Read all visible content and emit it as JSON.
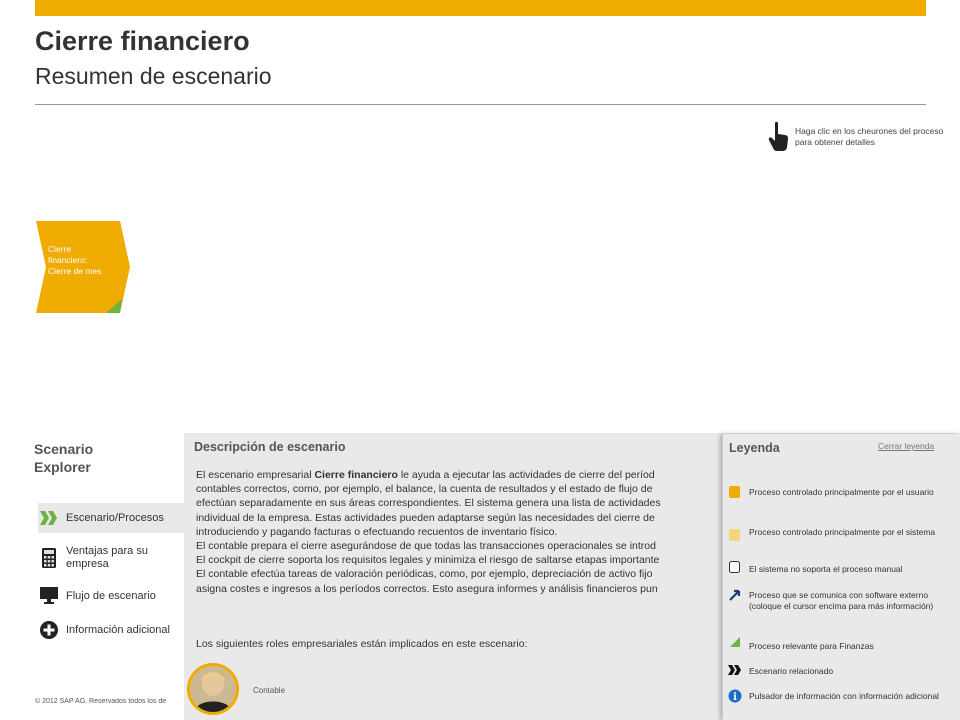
{
  "header": {
    "title": "Cierre financiero",
    "subtitle": "Resumen de escenario",
    "accent_color": "#f0ab00"
  },
  "hint": {
    "icon": "hand-pointer-icon",
    "text": "Haga clic en los cheurones del proceso para obtener detalles"
  },
  "process": {
    "chevron_label": "Cierre financiero: Cierre de mes",
    "chevron_color": "#f0ab00",
    "corner_color": "#6db33f"
  },
  "explorer": {
    "title": "Scenario Explorer",
    "items": [
      {
        "label": "Escenario/Procesos",
        "icon": "double-chevron-icon"
      },
      {
        "label": "Ventajas para su empresa",
        "icon": "calculator-icon"
      },
      {
        "label": "Flujo de escenario",
        "icon": "monitor-icon"
      },
      {
        "label": "Información adicional",
        "icon": "plus-circle-icon"
      }
    ]
  },
  "footer": {
    "copyright": "© 2012 SAP AG. Reservados todos los de"
  },
  "description": {
    "title": "Descripción de escenario",
    "lines": {
      "l1_pre": "El escenario empresarial ",
      "l1_bold": "Cierre financiero",
      "l1_post": " le ayuda a ejecutar las actividades de cierre del períod",
      "l2": "contables correctos, como, por ejemplo, el balance, la cuenta de resultados y el estado de flujo de",
      "l3": "efectúan separadamente en sus áreas correspondientes. El sistema genera una lista de actividades",
      "l4": "individual de la empresa. Estas actividades pueden adaptarse según las necesidades del cierre de",
      "l5": "introduciendo y pagando facturas o efectuando recuentos de inventario físico.",
      "l6": "El contable prepara el cierre asegurándose de que todas las transacciones operacionales se introd",
      "l7": "El cockpit de cierre soporta los requisitos legales y minimiza el riesgo de saltarse etapas importante",
      "l8": "El contable efectúa tareas de valoración periódicas, como, por ejemplo, depreciación de activo fijo",
      "l9": "asigna costes e ingresos a los períodos correctos. Esto asegura informes y análisis financieros pun"
    },
    "roles_intro": "Los siguientes roles empresariales están implicados en este escenario:",
    "role_label": "Contable"
  },
  "legend": {
    "title": "Leyenda",
    "close_label": "Cerrar leyenda",
    "items": [
      {
        "icon": "user-process-icon",
        "label": "Proceso controlado principalmente por el usuario"
      },
      {
        "icon": "system-process-icon",
        "label": "Proceso controlado principalmente por el sistema"
      },
      {
        "icon": "manual-process-icon",
        "label": "El sistema no soporta el proceso manual"
      },
      {
        "icon": "external-software-icon",
        "label": "Proceso que se comunica con software externo (coloque el cursor encima para más información)"
      },
      {
        "icon": "finance-relevant-icon",
        "label": "Proceso relevante para Finanzas"
      },
      {
        "icon": "related-scenario-icon",
        "label": "Escenario relacionado"
      },
      {
        "icon": "info-button-icon",
        "label": "Pulsador de información con información adicional"
      }
    ]
  }
}
